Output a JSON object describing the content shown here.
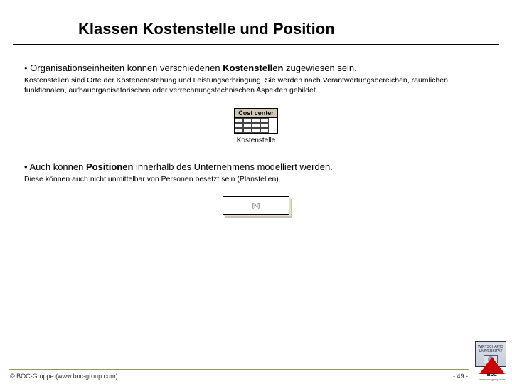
{
  "title": "Klassen Kostenstelle und Position",
  "bullet1_pre": "• Organisationseinheiten können verschiedenen ",
  "bullet1_bold": "Kostenstellen",
  "bullet1_post": " zugewiesen sein.",
  "desc1": "Kostenstellen sind Orte der Kostenentstehung und Leistungserbringung. Sie werden nach Verantwortungsbereichen, räumlichen, funktionalen, aufbauorganisatorischen oder verrechnungstechnischen Aspekten gebildet.",
  "fig1_header": "Cost center",
  "fig1_label": "Kostenstelle",
  "bullet2_pre": "• Auch können ",
  "bullet2_bold": "Positionen",
  "bullet2_post": " innerhalb des Unternehmens modelliert werden.",
  "desc2": "Diese können auch nicht unmittelbar von Personen besetzt sein (Planstellen).",
  "fig2_label": "[N]",
  "copyright": "© BOC-Gruppe (www.boc-group.com)",
  "pagenum": "- 49 -",
  "logo_uni_top": "WIRTSCHAFTS",
  "logo_uni_mid": "UNIVERSITÄT",
  "logo_boc_text": "BoC",
  "logo_boc_url": "www.boc-group.com"
}
